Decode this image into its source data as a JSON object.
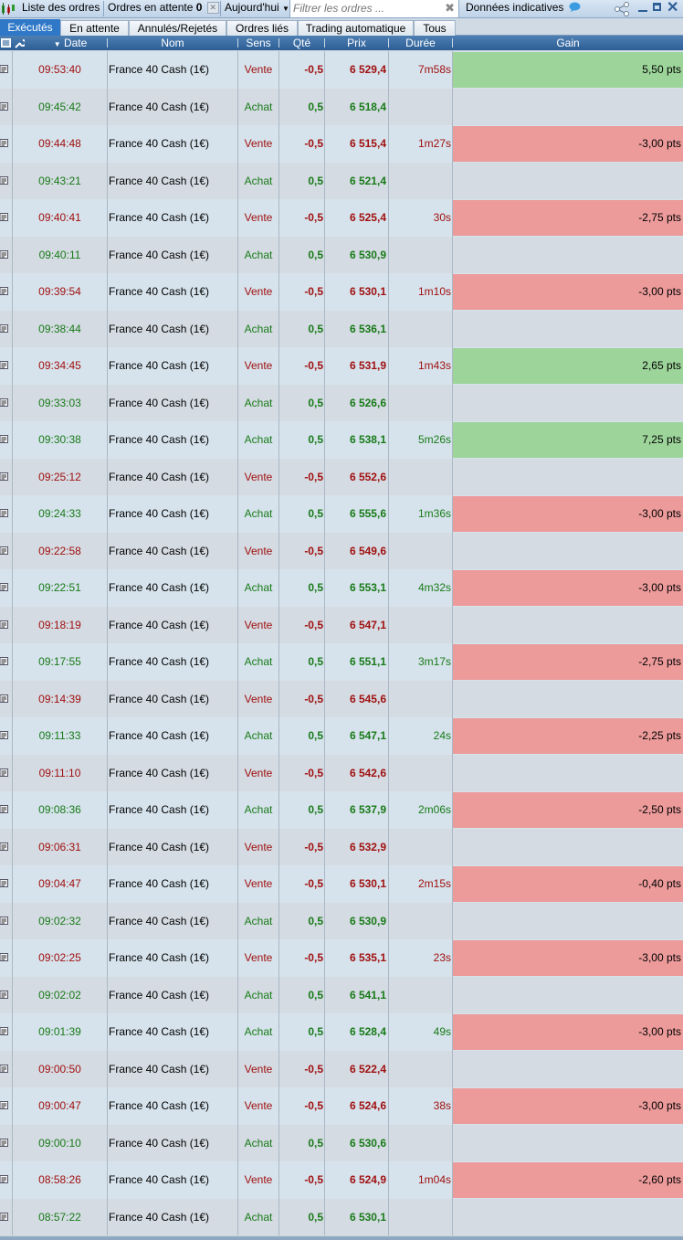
{
  "toolbar": {
    "orders_list": "Liste des ordres",
    "pending_orders": "Ordres en attente",
    "pending_count": "0",
    "period": "Aujourd'hui",
    "filter_placeholder": "Filtrer les ordres ...",
    "indicative": "Données indicatives"
  },
  "tabs": [
    {
      "label": "Exécutés",
      "active": true
    },
    {
      "label": "En attente",
      "active": false
    },
    {
      "label": "Annulés/Rejetés",
      "active": false
    },
    {
      "label": "Ordres liés",
      "active": false
    },
    {
      "label": "Trading automatique",
      "active": false
    },
    {
      "label": "Tous",
      "active": false
    }
  ],
  "columns": {
    "date": "Date",
    "name": "Nom",
    "side": "Sens",
    "qty": "Qté",
    "price": "Prix",
    "duration": "Durée",
    "gain": "Gain"
  },
  "colors": {
    "sell": "#a01010",
    "buy": "#187a18",
    "gain_positive": "#9cd49a",
    "gain_negative": "#ec9a9a",
    "accent": "#2f78c8"
  },
  "rows": [
    {
      "time": "09:53:40",
      "name": "France 40 Cash (1€)",
      "side": "Vente",
      "qty": "-0,5",
      "price": "6 529,4",
      "duration": "7m58s",
      "gain": "5,50 pts",
      "gain_sign": "pos"
    },
    {
      "time": "09:45:42",
      "name": "France 40 Cash (1€)",
      "side": "Achat",
      "qty": "0,5",
      "price": "6 518,4",
      "duration": "",
      "gain": "",
      "gain_sign": ""
    },
    {
      "time": "09:44:48",
      "name": "France 40 Cash (1€)",
      "side": "Vente",
      "qty": "-0,5",
      "price": "6 515,4",
      "duration": "1m27s",
      "gain": "-3,00 pts",
      "gain_sign": "neg"
    },
    {
      "time": "09:43:21",
      "name": "France 40 Cash (1€)",
      "side": "Achat",
      "qty": "0,5",
      "price": "6 521,4",
      "duration": "",
      "gain": "",
      "gain_sign": ""
    },
    {
      "time": "09:40:41",
      "name": "France 40 Cash (1€)",
      "side": "Vente",
      "qty": "-0,5",
      "price": "6 525,4",
      "duration": "30s",
      "gain": "-2,75 pts",
      "gain_sign": "neg"
    },
    {
      "time": "09:40:11",
      "name": "France 40 Cash (1€)",
      "side": "Achat",
      "qty": "0,5",
      "price": "6 530,9",
      "duration": "",
      "gain": "",
      "gain_sign": ""
    },
    {
      "time": "09:39:54",
      "name": "France 40 Cash (1€)",
      "side": "Vente",
      "qty": "-0,5",
      "price": "6 530,1",
      "duration": "1m10s",
      "gain": "-3,00 pts",
      "gain_sign": "neg"
    },
    {
      "time": "09:38:44",
      "name": "France 40 Cash (1€)",
      "side": "Achat",
      "qty": "0,5",
      "price": "6 536,1",
      "duration": "",
      "gain": "",
      "gain_sign": ""
    },
    {
      "time": "09:34:45",
      "name": "France 40 Cash (1€)",
      "side": "Vente",
      "qty": "-0,5",
      "price": "6 531,9",
      "duration": "1m43s",
      "gain": "2,65 pts",
      "gain_sign": "pos"
    },
    {
      "time": "09:33:03",
      "name": "France 40 Cash (1€)",
      "side": "Achat",
      "qty": "0,5",
      "price": "6 526,6",
      "duration": "",
      "gain": "",
      "gain_sign": ""
    },
    {
      "time": "09:30:38",
      "name": "France 40 Cash (1€)",
      "side": "Achat",
      "qty": "0,5",
      "price": "6 538,1",
      "duration": "5m26s",
      "gain": "7,25 pts",
      "gain_sign": "pos"
    },
    {
      "time": "09:25:12",
      "name": "France 40 Cash (1€)",
      "side": "Vente",
      "qty": "-0,5",
      "price": "6 552,6",
      "duration": "",
      "gain": "",
      "gain_sign": ""
    },
    {
      "time": "09:24:33",
      "name": "France 40 Cash (1€)",
      "side": "Achat",
      "qty": "0,5",
      "price": "6 555,6",
      "duration": "1m36s",
      "gain": "-3,00 pts",
      "gain_sign": "neg"
    },
    {
      "time": "09:22:58",
      "name": "France 40 Cash (1€)",
      "side": "Vente",
      "qty": "-0,5",
      "price": "6 549,6",
      "duration": "",
      "gain": "",
      "gain_sign": ""
    },
    {
      "time": "09:22:51",
      "name": "France 40 Cash (1€)",
      "side": "Achat",
      "qty": "0,5",
      "price": "6 553,1",
      "duration": "4m32s",
      "gain": "-3,00 pts",
      "gain_sign": "neg"
    },
    {
      "time": "09:18:19",
      "name": "France 40 Cash (1€)",
      "side": "Vente",
      "qty": "-0,5",
      "price": "6 547,1",
      "duration": "",
      "gain": "",
      "gain_sign": ""
    },
    {
      "time": "09:17:55",
      "name": "France 40 Cash (1€)",
      "side": "Achat",
      "qty": "0,5",
      "price": "6 551,1",
      "duration": "3m17s",
      "gain": "-2,75 pts",
      "gain_sign": "neg"
    },
    {
      "time": "09:14:39",
      "name": "France 40 Cash (1€)",
      "side": "Vente",
      "qty": "-0,5",
      "price": "6 545,6",
      "duration": "",
      "gain": "",
      "gain_sign": ""
    },
    {
      "time": "09:11:33",
      "name": "France 40 Cash (1€)",
      "side": "Achat",
      "qty": "0,5",
      "price": "6 547,1",
      "duration": "24s",
      "gain": "-2,25 pts",
      "gain_sign": "neg"
    },
    {
      "time": "09:11:10",
      "name": "France 40 Cash (1€)",
      "side": "Vente",
      "qty": "-0,5",
      "price": "6 542,6",
      "duration": "",
      "gain": "",
      "gain_sign": ""
    },
    {
      "time": "09:08:36",
      "name": "France 40 Cash (1€)",
      "side": "Achat",
      "qty": "0,5",
      "price": "6 537,9",
      "duration": "2m06s",
      "gain": "-2,50 pts",
      "gain_sign": "neg"
    },
    {
      "time": "09:06:31",
      "name": "France 40 Cash (1€)",
      "side": "Vente",
      "qty": "-0,5",
      "price": "6 532,9",
      "duration": "",
      "gain": "",
      "gain_sign": ""
    },
    {
      "time": "09:04:47",
      "name": "France 40 Cash (1€)",
      "side": "Vente",
      "qty": "-0,5",
      "price": "6 530,1",
      "duration": "2m15s",
      "gain": "-0,40 pts",
      "gain_sign": "neg"
    },
    {
      "time": "09:02:32",
      "name": "France 40 Cash (1€)",
      "side": "Achat",
      "qty": "0,5",
      "price": "6 530,9",
      "duration": "",
      "gain": "",
      "gain_sign": ""
    },
    {
      "time": "09:02:25",
      "name": "France 40 Cash (1€)",
      "side": "Vente",
      "qty": "-0,5",
      "price": "6 535,1",
      "duration": "23s",
      "gain": "-3,00 pts",
      "gain_sign": "neg"
    },
    {
      "time": "09:02:02",
      "name": "France 40 Cash (1€)",
      "side": "Achat",
      "qty": "0,5",
      "price": "6 541,1",
      "duration": "",
      "gain": "",
      "gain_sign": ""
    },
    {
      "time": "09:01:39",
      "name": "France 40 Cash (1€)",
      "side": "Achat",
      "qty": "0,5",
      "price": "6 528,4",
      "duration": "49s",
      "gain": "-3,00 pts",
      "gain_sign": "neg"
    },
    {
      "time": "09:00:50",
      "name": "France 40 Cash (1€)",
      "side": "Vente",
      "qty": "-0,5",
      "price": "6 522,4",
      "duration": "",
      "gain": "",
      "gain_sign": ""
    },
    {
      "time": "09:00:47",
      "name": "France 40 Cash (1€)",
      "side": "Vente",
      "qty": "-0,5",
      "price": "6 524,6",
      "duration": "38s",
      "gain": "-3,00 pts",
      "gain_sign": "neg"
    },
    {
      "time": "09:00:10",
      "name": "France 40 Cash (1€)",
      "side": "Achat",
      "qty": "0,5",
      "price": "6 530,6",
      "duration": "",
      "gain": "",
      "gain_sign": ""
    },
    {
      "time": "08:58:26",
      "name": "France 40 Cash (1€)",
      "side": "Vente",
      "qty": "-0,5",
      "price": "6 524,9",
      "duration": "1m04s",
      "gain": "-2,60 pts",
      "gain_sign": "neg"
    },
    {
      "time": "08:57:22",
      "name": "France 40 Cash (1€)",
      "side": "Achat",
      "qty": "0,5",
      "price": "6 530,1",
      "duration": "",
      "gain": "",
      "gain_sign": ""
    }
  ]
}
